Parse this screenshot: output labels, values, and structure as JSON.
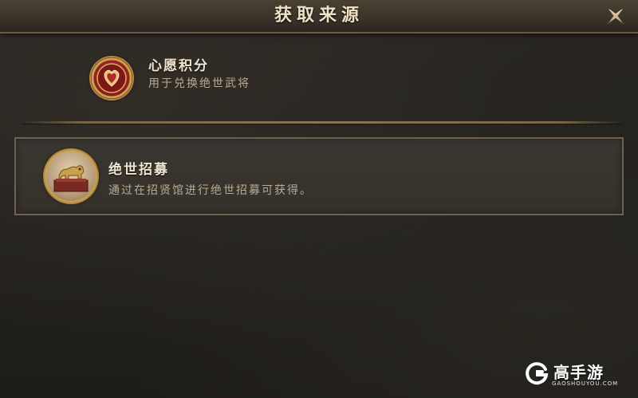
{
  "dialog": {
    "title": "获取来源"
  },
  "sources": [
    {
      "title": "心愿积分",
      "description": "用于兑换绝世武将",
      "icon": "heart-coin-icon"
    },
    {
      "title": "绝世招募",
      "description": "通过在招贤馆进行绝世招募可获得。",
      "icon": "golden-beast-seal-icon"
    }
  ],
  "watermark": {
    "brand": "高手游",
    "site": "GAOSHOUYOU.COM",
    "icon": "g-logo-icon"
  },
  "colors": {
    "title_text": "#efe2c4",
    "item_title": "#f1e6cf",
    "item_desc": "#b8ab92",
    "border_gold": "#6f614b",
    "coin_red": "#8e1f1f",
    "coin_gold": "#c9a24a"
  }
}
